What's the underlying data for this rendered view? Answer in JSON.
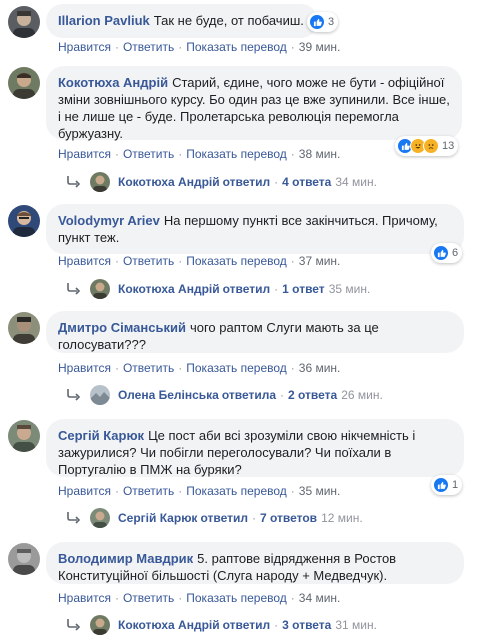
{
  "actions": {
    "like": "Нравится",
    "reply": "Ответить",
    "translate": "Показать перевод",
    "separator": "·"
  },
  "comments": [
    {
      "author": "Illarion Pavliuk",
      "text": "Так не буде, от побачиш.",
      "reactions": {
        "icons": [
          "like-icon"
        ],
        "count": "3"
      },
      "time": "39 мин."
    },
    {
      "author": "Кокотюха Андрій",
      "text": "Старий, єдине, чого може не бути - офіційної зміни зовнішнього курсу. Бо один раз це вже зупинили. Все інше, і не лише це - буде. Пролетарська революція перемогла буржуазну.",
      "reactions": {
        "icons": [
          "like-icon",
          "laugh-icon",
          "sad-icon"
        ],
        "count": "13"
      },
      "time": "38 мин.",
      "replies": {
        "name": "Кокотюха Андрій",
        "verb": "ответил",
        "count": "4 ответа",
        "time": "34 мин."
      }
    },
    {
      "author": "Volodymyr Ariev",
      "text": "На першому пункті все закінчиться. Причому, пункт теж.",
      "reactions": {
        "icons": [
          "like-icon"
        ],
        "count": "6"
      },
      "time": "37 мин.",
      "replies": {
        "name": "Кокотюха Андрій",
        "verb": "ответил",
        "count": "1 ответ",
        "time": "35 мин."
      }
    },
    {
      "author": "Дмитро Сіманський",
      "text": "чого раптом Слуги мають за це голосувати???",
      "time": "36 мин.",
      "replies": {
        "name": "Олена Белінська",
        "verb": "ответила",
        "count": "2 ответа",
        "time": "26 мин."
      }
    },
    {
      "author": "Сергій Карюк",
      "text": "Це пост аби всі зрозуміли свою нікчемність і зажурилися? Чи побігли переголосували? Чи поїхали в Португалію в ПМЖ на буряки?",
      "reactions": {
        "icons": [
          "like-icon"
        ],
        "count": "1"
      },
      "time": "35 мин.",
      "replies": {
        "name": "Сергій Карюк",
        "verb": "ответил",
        "count": "7 ответов",
        "time": "12 мин."
      }
    },
    {
      "author": "Володимир Мавдрик",
      "text": "5. раптове відрядження в Ростов Конституційної більшості (Слуга народу + Медведчук).",
      "time": "34 мин.",
      "replies": {
        "name": "Кокотюха Андрій",
        "verb": "ответил",
        "count": "3 ответа",
        "time": "31 мин."
      }
    }
  ]
}
